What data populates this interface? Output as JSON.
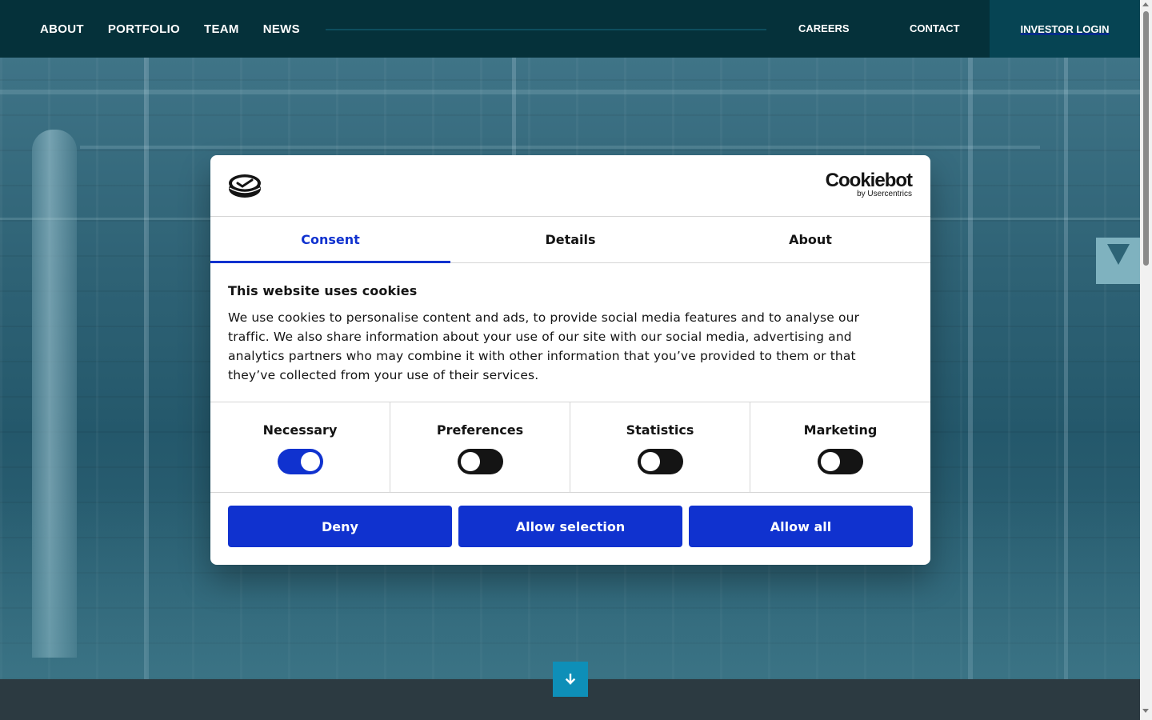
{
  "nav": {
    "left": [
      "ABOUT",
      "PORTFOLIO",
      "TEAM",
      "NEWS"
    ],
    "careers": "CAREERS",
    "contact": "CONTACT",
    "investor_login": "INVESTOR LOGIN"
  },
  "cookie_dialog": {
    "brand_name": "Cookiebot",
    "brand_by": "by Usercentrics",
    "tabs": [
      "Consent",
      "Details",
      "About"
    ],
    "active_tab": "Consent",
    "title": "This website uses cookies",
    "body": "We use cookies to personalise content and ads, to provide social media features and to analyse our traffic. We also share information about your use of our site with our social media, advertising and analytics partners who may combine it with other information that you’ve provided to them or that they’ve collected from your use of their services.",
    "toggles": [
      {
        "label": "Necessary",
        "on": true
      },
      {
        "label": "Preferences",
        "on": false
      },
      {
        "label": "Statistics",
        "on": false
      },
      {
        "label": "Marketing",
        "on": false
      }
    ],
    "buttons": {
      "deny": "Deny",
      "allow_selection": "Allow selection",
      "allow_all": "Allow all"
    }
  },
  "colors": {
    "nav_bg": "#05313a",
    "accent": "#1032cf",
    "scroll_button": "#0e8fb8"
  },
  "icons": {
    "scroll_down": "arrow-down-icon",
    "cookiebot": "cookiebot-logo-icon"
  }
}
